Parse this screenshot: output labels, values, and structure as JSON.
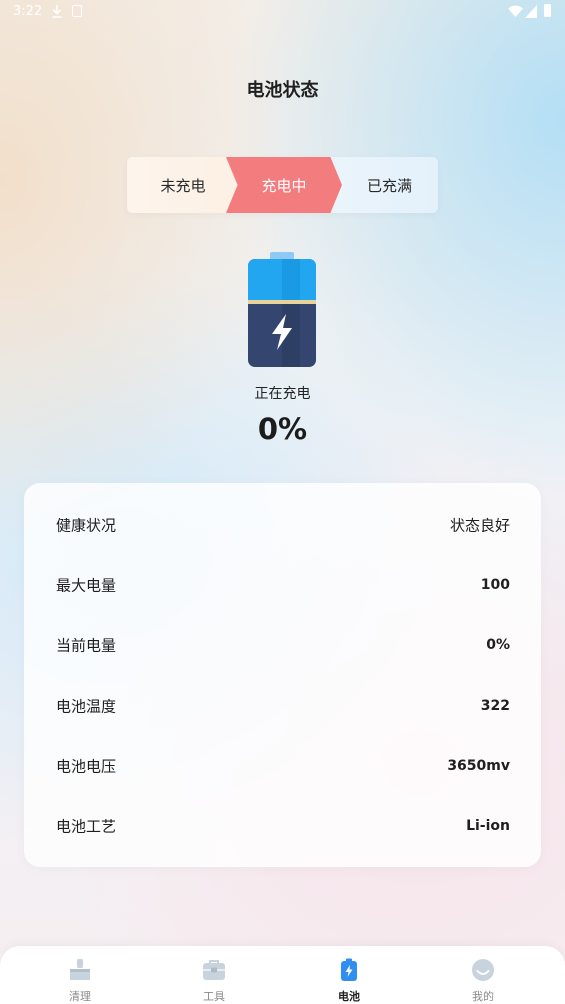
{
  "status_bar": {
    "time": "3:22"
  },
  "page": {
    "title": "电池状态"
  },
  "stages": {
    "items": [
      "未充电",
      "充电中",
      "已充满"
    ],
    "active": "充电中",
    "active_color": "#f27c7e"
  },
  "battery": {
    "icon": "battery-charging-icon",
    "status_text": "正在充电",
    "percent": "0%"
  },
  "info": {
    "rows": [
      {
        "label": "健康状况",
        "value": "状态良好"
      },
      {
        "label": "最大电量",
        "value": "100"
      },
      {
        "label": "当前电量",
        "value": "0%"
      },
      {
        "label": "电池温度",
        "value": "322"
      },
      {
        "label": "电池电压",
        "value": "3650mv"
      },
      {
        "label": "电池工艺",
        "value": "Li-ion"
      }
    ]
  },
  "nav": {
    "items": [
      {
        "label": "清理",
        "icon": "broom-icon"
      },
      {
        "label": "工具",
        "icon": "toolbox-icon"
      },
      {
        "label": "电池",
        "icon": "battery-icon"
      },
      {
        "label": "我的",
        "icon": "profile-icon"
      }
    ],
    "active": "电池",
    "accent": "#2f8ff0"
  }
}
